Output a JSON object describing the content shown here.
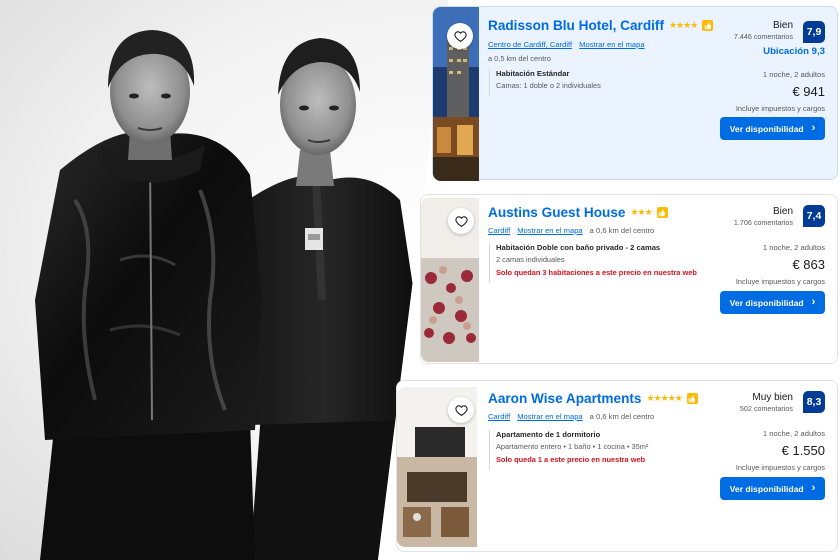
{
  "theme": {
    "link_blue": "#006ce4",
    "score_navy": "#003b95",
    "star_yellow": "#febb02",
    "warning_red": "#d4111e",
    "highlight_bg": "#eaf3ff"
  },
  "listings": [
    {
      "name": "Radisson Blu Hotel, Cardiff",
      "stars": "★★★★",
      "area_link": "Centro de Cardiff, Cardiff",
      "map_link": "Mostrar en el mapa",
      "distance": "a 0,5 km del centro",
      "review_word": "Bien",
      "review_count": "7.446 comentarios",
      "score": "7,9",
      "location_score": "Ubicación 9,3",
      "room_name": "Habitación Estándar",
      "room_beds": "Camas: 1 doble o 2 individuales",
      "room_warning": "",
      "nights": "1 noche, 2 adultos",
      "price": "€ 941",
      "taxes": "Incluye impuestos y cargos",
      "cta": "Ver disponibilidad"
    },
    {
      "name": "Austins Guest House",
      "stars": "★★★",
      "area_link": "Cardiff",
      "map_link": "Mostrar en el mapa",
      "distance": "a 0,6 km del centro",
      "review_word": "Bien",
      "review_count": "1.706 comentarios",
      "score": "7,4",
      "location_score": "",
      "room_name": "Habitación Doble con baño privado - 2 camas",
      "room_beds": "2 camas individuales",
      "room_warning": "Solo quedan 3 habitaciones a este precio en nuestra web",
      "nights": "1 noche, 2 adultos",
      "price": "€ 863",
      "taxes": "Incluye impuestos y cargos",
      "cta": "Ver disponibilidad"
    },
    {
      "name": "Aaron Wise Apartments",
      "stars": "★★★★★",
      "area_link": "Cardiff",
      "map_link": "Mostrar en el mapa",
      "distance": "a 0,6 km del centro",
      "review_word": "Muy bien",
      "review_count": "502 comentarios",
      "score": "8,3",
      "location_score": "",
      "room_name": "Apartamento de 1 dormitorio",
      "room_beds": "Apartamento entero • 1 baño • 1 cocina • 35m²",
      "room_warning": "Solo queda 1 a este precio en nuestra web",
      "nights": "1 noche, 2 adultos",
      "price": "€ 1.550",
      "taxes": "Incluye impuestos y cargos",
      "cta": "Ver disponibilidad"
    }
  ],
  "icons": {
    "favorite": "heart-outline-icon",
    "thumbs": "thumbs-up-icon",
    "chevron": "chevron-right-icon"
  }
}
